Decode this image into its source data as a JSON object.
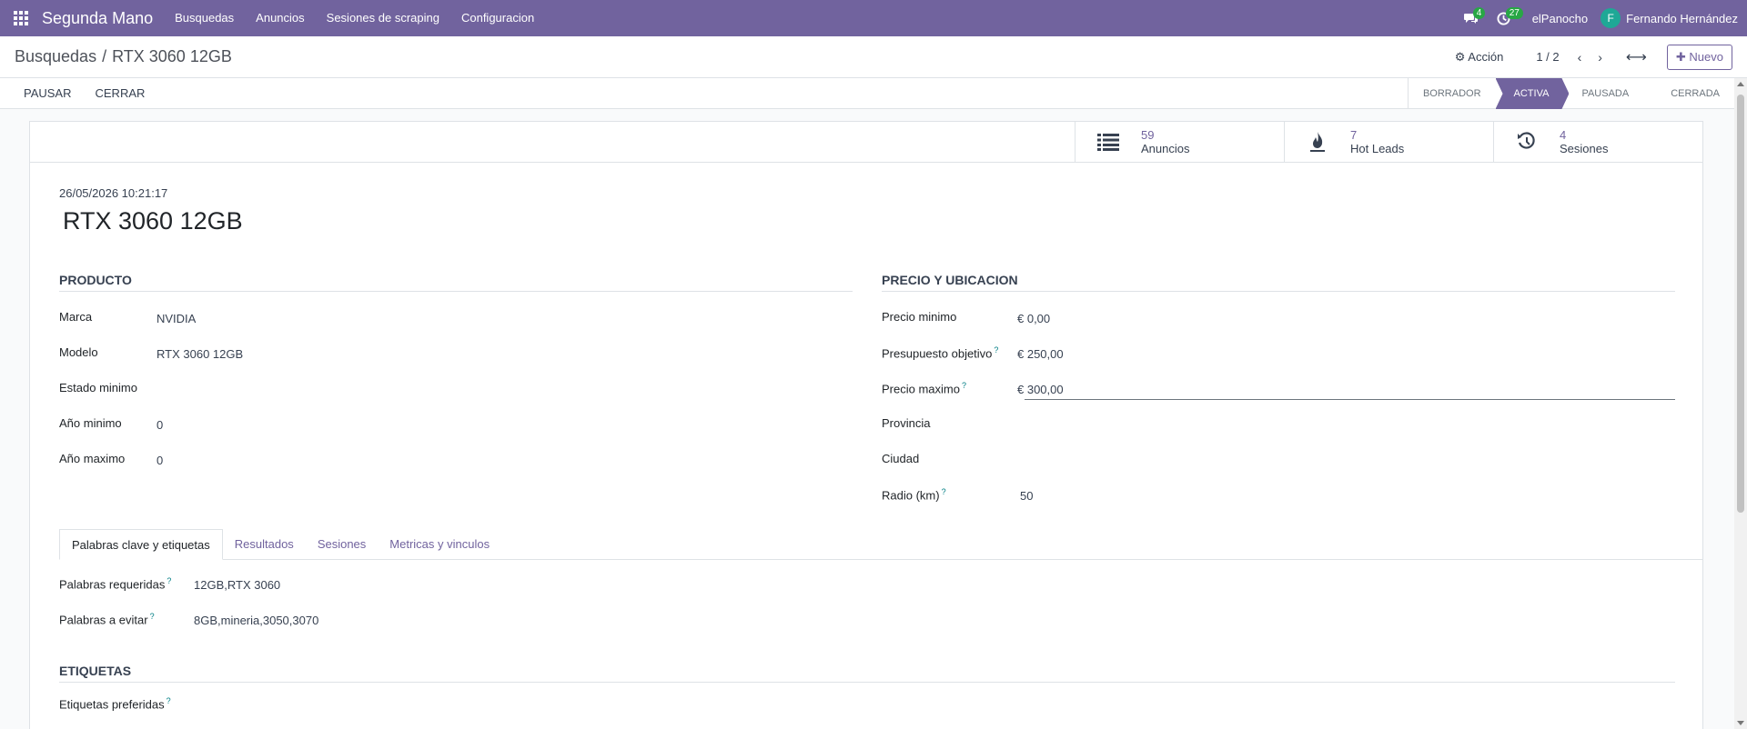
{
  "navbar": {
    "brand": "Segunda Mano",
    "menu": [
      "Busquedas",
      "Anuncios",
      "Sesiones de scraping",
      "Configuracion"
    ],
    "messages_count": "4",
    "activities_count": "27",
    "company": "elPanocho",
    "user_initial": "F",
    "user_name": "Fernando Hernández",
    "accent": "#71639e"
  },
  "control_panel": {
    "breadcrumb_parent": "Busquedas",
    "breadcrumb_sep": "/",
    "breadcrumb_current": "RTX 3060 12GB",
    "action_label": "Acción",
    "pager": "1 / 2",
    "new_label": "Nuevo"
  },
  "statusbar": {
    "buttons": [
      "PAUSAR",
      "CERRAR"
    ],
    "stages": [
      "BORRADOR",
      "ACTIVA",
      "PAUSADA",
      "CERRADA"
    ],
    "active_stage": "ACTIVA"
  },
  "smart_buttons": [
    {
      "icon": "list-icon",
      "value": "59",
      "label": "Anuncios"
    },
    {
      "icon": "fire-icon",
      "value": "7",
      "label": "Hot Leads"
    },
    {
      "icon": "history-icon",
      "value": "4",
      "label": "Sesiones"
    }
  ],
  "record": {
    "date": "26/05/2026 10:21:17",
    "title": "RTX 3060 12GB"
  },
  "producto": {
    "title": "PRODUCTO",
    "fields": [
      {
        "label": "Marca",
        "value": "NVIDIA"
      },
      {
        "label": "Modelo",
        "value": "RTX 3060 12GB"
      },
      {
        "label": "Estado minimo",
        "value": ""
      },
      {
        "label": "Año minimo",
        "value": "0"
      },
      {
        "label": "Año maximo",
        "value": "0"
      }
    ]
  },
  "precio": {
    "title": "PRECIO Y UBICACION",
    "fields": [
      {
        "label": "Precio minimo",
        "value": "€ 0,00",
        "help": false
      },
      {
        "label": "Presupuesto objetivo",
        "value": "€ 250,00",
        "help": true
      },
      {
        "label": "Precio maximo",
        "value": "€ 300,00",
        "help": true
      },
      {
        "label": "Provincia",
        "value": "",
        "help": false
      },
      {
        "label": "Ciudad",
        "value": "",
        "help": false
      },
      {
        "label": "Radio (km)",
        "value": "50",
        "help": true
      }
    ]
  },
  "tabs": [
    "Palabras clave y etiquetas",
    "Resultados",
    "Sesiones",
    "Metricas y vinculos"
  ],
  "keywords": {
    "required_label": "Palabras requeridas",
    "required_value": "12GB,RTX 3060",
    "avoid_label": "Palabras a evitar",
    "avoid_value": "8GB,mineria,3050,3070",
    "help": "?"
  },
  "etiquetas": {
    "title": "ETIQUETAS",
    "preferred_label": "Etiquetas preferidas"
  }
}
